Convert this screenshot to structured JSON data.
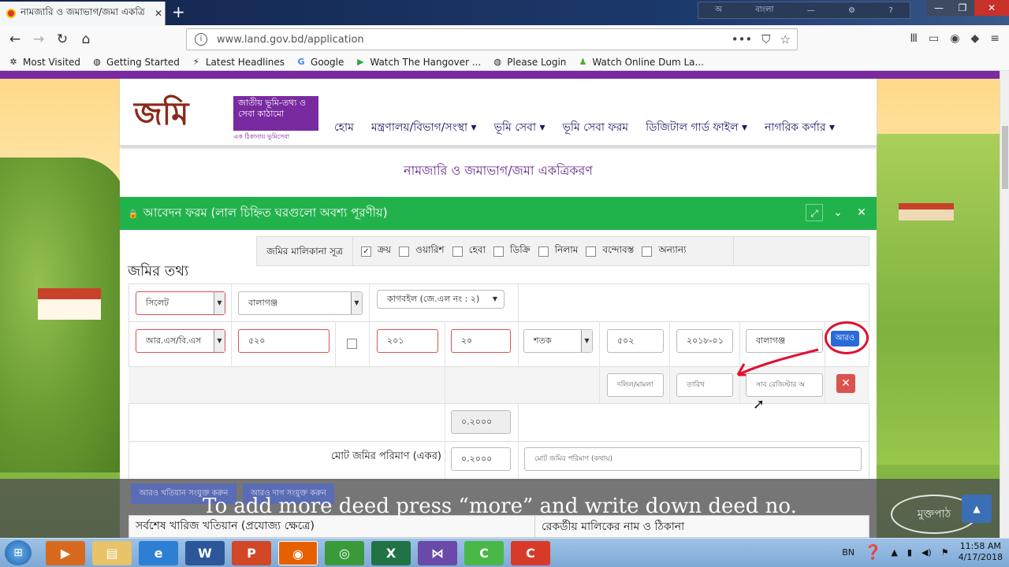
{
  "browser": {
    "tab_title": "নামজারি ও জমাভাগ/জমা একত্রি",
    "new_tab": "+",
    "url": "www.land.gov.bd/application",
    "url_dots": "•••",
    "lang_bar": "বাংলা",
    "bookmarks": [
      "Most Visited",
      "Getting Started",
      "Latest Headlines",
      "Google",
      "Watch The Hangover ...",
      "Please Login",
      "Watch Online Dum La..."
    ]
  },
  "site": {
    "logo_big": "জমি",
    "logo_box": "জাতীয় ভূমি-তথ্য ও সেবা কাঠামো",
    "logo_sub": "এক ঠিকানায় ভূমিসেবা",
    "menu": [
      "হোম",
      "মন্ত্রণালয়/বিভাগ/সংস্থা ▾",
      "ভূমি সেবা ▾",
      "ভূমি সেবা ফরম",
      "ডিজিটাল গার্ড ফাইল ▾",
      "নাগরিক কর্ণার ▾"
    ],
    "page_title": "নামজারি ও জমাভাগ/জমা একত্রিকরণ"
  },
  "form": {
    "header": "আবেদন ফরম  (লাল চিহ্নিত ঘরগুলো অবশ্য পূরণীয়)",
    "section_title": "জমির তথ্য",
    "ownership_label": "জমির মালিকানা সূত্র",
    "ownership_options": [
      {
        "label": "ক্রয়",
        "checked": true
      },
      {
        "label": "ওয়ারিশ",
        "checked": false
      },
      {
        "label": "হেবা",
        "checked": false
      },
      {
        "label": "ডিক্রি",
        "checked": false
      },
      {
        "label": "নিলাম",
        "checked": false
      },
      {
        "label": "বন্দোবস্ত",
        "checked": false
      },
      {
        "label": "অন্যান্য",
        "checked": false
      }
    ],
    "district": "সিলেট",
    "upazila": "বালাগঞ্জ",
    "mouza": "কাগবইল (জে.এল নং : ২)",
    "survey": "আর.এস/বি.এস",
    "khatian": "৫২০",
    "dag1": "২০১",
    "dag2": "২০",
    "unit": "শতক",
    "amount": "৫০২",
    "date": "২০১৮-০১",
    "office": "বালাগঞ্জ",
    "more_button": "আরও",
    "deed_placeholder": "দলিল/মামলা",
    "date_placeholder": "তারিখ",
    "registry_placeholder": "সাব রেজিস্টার অ",
    "subtotal": "০.২০০০",
    "total_label": "মোট জমির পরিমাণ (একর)",
    "total_value": "০.২০০০",
    "total_placeholder": "মোট জমির পরিমাণ (কথায়)",
    "add_khatian_button": "আরও খতিয়ান সংযুক্ত করুন",
    "add_dag_button": "আরও দাগ সংযুক্ত করুন",
    "bottom_left": "সর্বশেষ খারিজ খতিয়ান (প্রযোজ্য ক্ষেত্রে)",
    "bottom_right": "রেকর্ডীয় মালিকের নাম ও ঠিকানা"
  },
  "caption": "To add more deed press “more” and write down deed no.",
  "stamp": "মুক্তপাঠ",
  "taskbar": {
    "lang": "BN",
    "time": "11:58 AM",
    "date": "4/17/2018"
  }
}
